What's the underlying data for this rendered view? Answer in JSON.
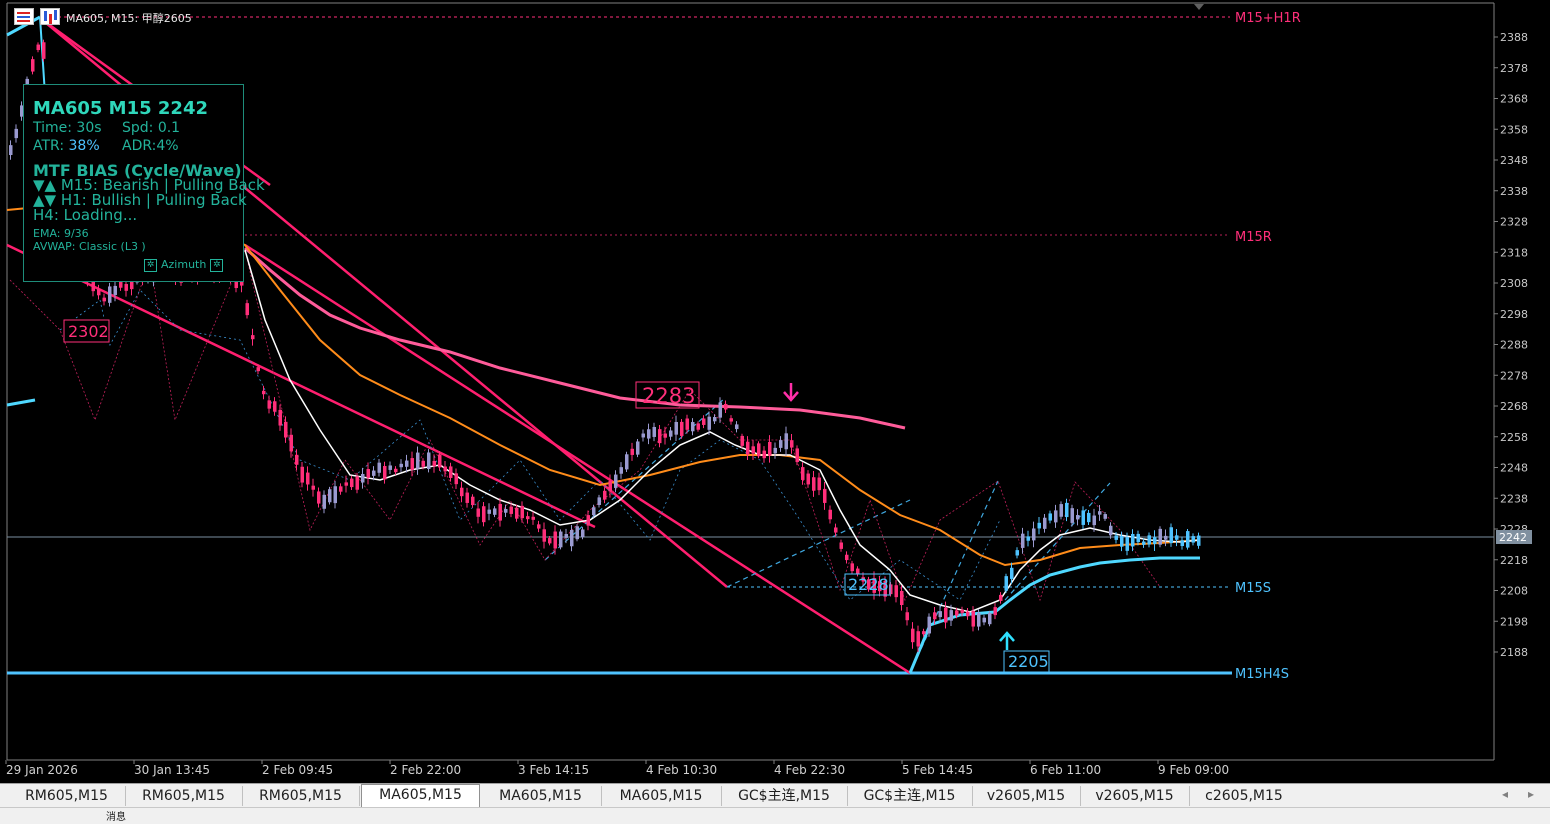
{
  "window": {
    "symbol_title": "MA605, M15:  甲醇2605"
  },
  "price_axis": {
    "labels": [
      "2388",
      "2378",
      "2368",
      "2358",
      "2348",
      "2338",
      "2328",
      "2318",
      "2308",
      "2298",
      "2288",
      "2278",
      "2268",
      "2258",
      "2248",
      "2238",
      "2228",
      "2218",
      "2208",
      "2198",
      "2188"
    ],
    "current_price": "2242"
  },
  "time_axis": {
    "labels": [
      "29 Jan 2026",
      "30 Jan 13:45",
      "2 Feb 09:45",
      "2 Feb 22:00",
      "3 Feb 14:15",
      "4 Feb 10:30",
      "4 Feb 22:30",
      "5 Feb 14:45",
      "6 Feb 11:00",
      "9 Feb 09:00"
    ]
  },
  "levels": [
    {
      "label": "M15+H1R",
      "color": "#ff2f7a"
    },
    {
      "label": "M15R",
      "color": "#ff2f7a"
    },
    {
      "label": "M15S",
      "color": "#4fc3ff"
    },
    {
      "label": "M15H4S",
      "color": "#4fc3ff"
    }
  ],
  "price_callouts": {
    "high_left": "2302",
    "high_mid": "2283",
    "low_mid": "2228",
    "low_right": "2205"
  },
  "info_panel": {
    "title": "MA605 M15 2242",
    "time_label": "Time: 30s",
    "spread_label": "Spd: 0.1",
    "atr_prefix": "ATR: ",
    "atr_value": "38%",
    "adr_label": "ADR:4%",
    "bias_heading": "MTF BIAS (Cycle/Wave)",
    "bias_m15": "▼▲ M15: Bearish | Pulling Back",
    "bias_h1": "▲▼ H1: Bullish | Pulling Back",
    "bias_h4": "H4: Loading...",
    "ema_line": "EMA: 9/36",
    "avwap_line": "AVWAP: Classic (L3 )",
    "brand": "Azimuth"
  },
  "tabs": [
    {
      "label": "RM605,M15"
    },
    {
      "label": "RM605,M15"
    },
    {
      "label": "RM605,M15"
    },
    {
      "label": "MA605,M15",
      "active": true
    },
    {
      "label": "MA605,M15"
    },
    {
      "label": "MA605,M15"
    },
    {
      "label": "GC$主连,M15"
    },
    {
      "label": "GC$主连,M15"
    },
    {
      "label": "v2605,M15"
    },
    {
      "label": "v2605,M15"
    },
    {
      "label": "c2605,M15"
    }
  ],
  "status": {
    "text": "消息"
  },
  "colors": {
    "bull_candle": "#4fc3ff",
    "bear_candle": "#ff2f7a",
    "neutral_candle": "#9a9ad0",
    "ema_fast": "#ffffff",
    "ema_slow": "#ff8c1a",
    "ma_long": "#ff5c9a",
    "avwap": "#4fd8ff",
    "panel_accent": "#23b39b"
  }
}
